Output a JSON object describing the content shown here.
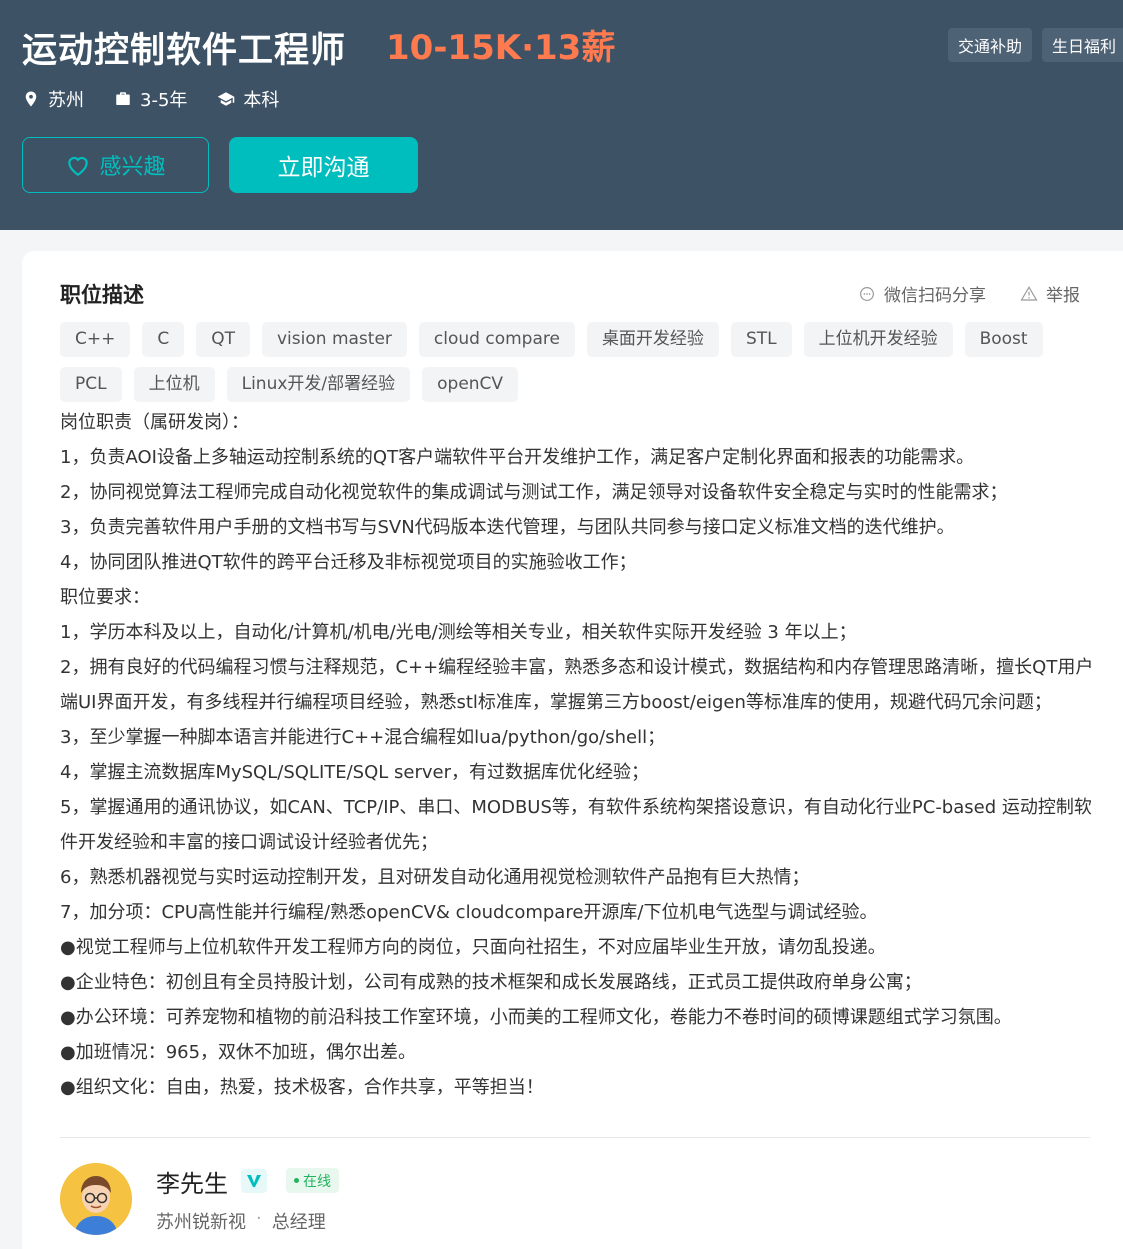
{
  "header": {
    "title": "运动控制软件工程师",
    "salary": "10-15K·13薪",
    "benefits": [
      "交通补助",
      "生日福利"
    ],
    "meta": {
      "city": "苏州",
      "experience": "3-5年",
      "education": "本科"
    },
    "interest_label": "感兴趣",
    "chat_label": "立即沟通"
  },
  "description": {
    "title": "职位描述",
    "share_label": "微信扫码分享",
    "report_label": "举报",
    "skills": [
      "C++",
      "C",
      "QT",
      "vision master",
      "cloud compare",
      "桌面开发经验",
      "STL",
      "上位机开发经验",
      "Boost",
      "PCL",
      "上位机",
      "Linux开发/部署经验",
      "openCV"
    ],
    "lines": [
      "岗位职责（属研发岗）：",
      "1，负责AOI设备上多轴运动控制系统的QT客户端软件平台开发维护工作，满足客户定制化界面和报表的功能需求。",
      "2，协同视觉算法工程师完成自动化视觉软件的集成调试与测试工作，满足领导对设备软件安全稳定与实时的性能需求；",
      "3，负责完善软件用户手册的文档书写与SVN代码版本迭代管理，与团队共同参与接口定义标准文档的迭代维护。",
      "4，协同团队推进QT软件的跨平台迁移及非标视觉项目的实施验收工作；",
      "职位要求：",
      "1，学历本科及以上，自动化/计算机/机电/光电/测绘等相关专业，相关软件实际开发经验 3 年以上；",
      "2，拥有良好的代码编程习惯与注释规范，C++编程经验丰富，熟悉多态和设计模式，数据结构和内存管理思路清晰，擅长QT用户端UI界面开发，有多线程并行编程项目经验，熟悉stl标准库，掌握第三方boost/eigen等标准库的使用，规避代码冗余问题；",
      "3，至少掌握一种脚本语言并能进行C++混合编程如lua/python/go/shell；",
      "4，掌握主流数据库MySQL/SQLITE/SQL server，有过数据库优化经验；",
      "5，掌握通用的通讯协议，如CAN、TCP/IP、串口、MODBUS等，有软件系统构架搭设意识，有自动化行业PC-based 运动控制软件开发经验和丰富的接口调试设计经验者优先；",
      "6，熟悉机器视觉与实时运动控制开发，且对研发自动化通用视觉检测软件产品抱有巨大热情；",
      "7，加分项：CPU高性能并行编程/熟悉openCV& cloudcompare开源库/下位机电气选型与调试经验。",
      "●视觉工程师与上位机软件开发工程师方向的岗位，只面向社招生，不对应届毕业生开放，请勿乱投递。",
      "●企业特色：初创且有全员持股计划，公司有成熟的技术框架和成长发展路线，正式员工提供政府单身公寓；",
      "●办公环境：可养宠物和植物的前沿科技工作室环境，小而美的工程师文化，卷能力不卷时间的硕博课题组式学习氛围。",
      "●加班情况：965，双休不加班，偶尔出差。",
      "●组织文化：自由，热爱，技术极客，合作共享，平等担当！"
    ]
  },
  "recruiter": {
    "name": "李先生",
    "status": "在线",
    "company": "苏州锐新视",
    "separator": "·",
    "position": "总经理"
  },
  "colors": {
    "header_bg": "#3e5266",
    "accent": "#00bebd",
    "salary": "#ff7a4f"
  }
}
